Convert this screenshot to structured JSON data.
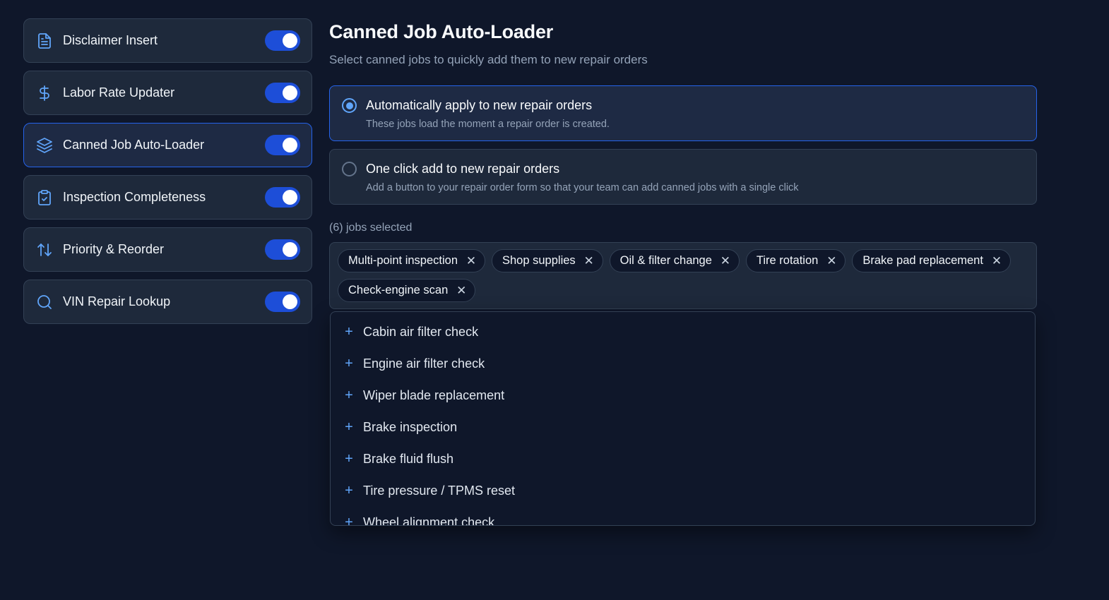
{
  "sidebar": {
    "items": [
      {
        "label": "Disclaimer Insert",
        "icon": "document-icon",
        "enabled": true
      },
      {
        "label": "Labor Rate Updater",
        "icon": "dollar-icon",
        "enabled": true
      },
      {
        "label": "Canned Job Auto-Loader",
        "icon": "layers-icon",
        "enabled": true,
        "active": true
      },
      {
        "label": "Inspection Completeness",
        "icon": "clipboard-check-icon",
        "enabled": true
      },
      {
        "label": "Priority & Reorder",
        "icon": "sort-arrows-icon",
        "enabled": true
      },
      {
        "label": "VIN Repair Lookup",
        "icon": "search-icon",
        "enabled": true
      }
    ]
  },
  "main": {
    "title": "Canned Job Auto-Loader",
    "subtitle": "Select canned jobs to quickly add them to new repair orders",
    "options": [
      {
        "title": "Automatically apply to new repair orders",
        "description": "These jobs load the moment a repair order is created.",
        "selected": true
      },
      {
        "title": "One click add to new repair orders",
        "description": "Add a button to your repair order form so that your team can add canned jobs with a single click",
        "selected": false
      }
    ],
    "selected_count": "(6) jobs selected",
    "chips": [
      "Multi-point inspection",
      "Shop supplies",
      "Oil & filter change",
      "Tire rotation",
      "Brake pad replacement",
      "Check-engine scan"
    ],
    "chip_remove_glyph": "✕",
    "dropdown_add_glyph": "+",
    "dropdown_items": [
      "Cabin air filter check",
      "Engine air filter check",
      "Wiper blade replacement",
      "Brake inspection",
      "Brake fluid flush",
      "Tire pressure / TPMS reset",
      "Wheel alignment check"
    ]
  },
  "colors": {
    "background": "#0f172a",
    "card": "#1e293b",
    "accent": "#2563eb",
    "icon": "#60a5fa",
    "muted_text": "#94a3b8"
  }
}
